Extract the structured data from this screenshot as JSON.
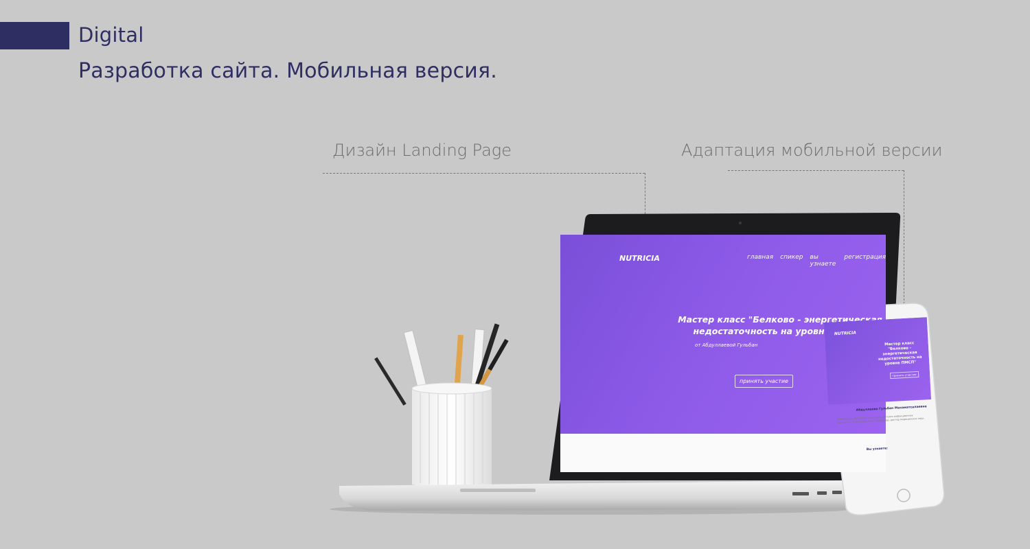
{
  "header": {
    "section_label": "Digital",
    "title": "Разработка сайта. Мобильная версия."
  },
  "callouts": {
    "landing_design": "Дизайн Landing Page",
    "mobile_adaptation": "Адаптация мобильной версии"
  },
  "landing_page": {
    "logo": "NUTRICIA",
    "nav": [
      "главная",
      "спикер",
      "вы узнаете",
      "регистрация"
    ],
    "headline": "Мастер класс \"Белково - энергетическая недостаточность на уровне ПМСП\"",
    "author": "от Абдуллаевой Гульбан",
    "cta": "принять участие"
  },
  "mobile_page": {
    "logo": "NUTRICIA",
    "headline": "Мастер класс \"Белково - энергетическая недостаточность на уровне ПМСП\"",
    "cta": "принять участие",
    "speaker_name": "Абдуллаева Гульбан Махаматсалаевна",
    "speaker_text": "заведующая кафедрой педиатрии, детских инфекционных болезней и эндокринологии. Профессор, доктор медицинских наук.",
    "learn_heading": "Вы узнаете:"
  },
  "colors": {
    "accent": "#2e2e63",
    "background": "#c9c9c9",
    "landing_purple": "#8d5ae8"
  }
}
